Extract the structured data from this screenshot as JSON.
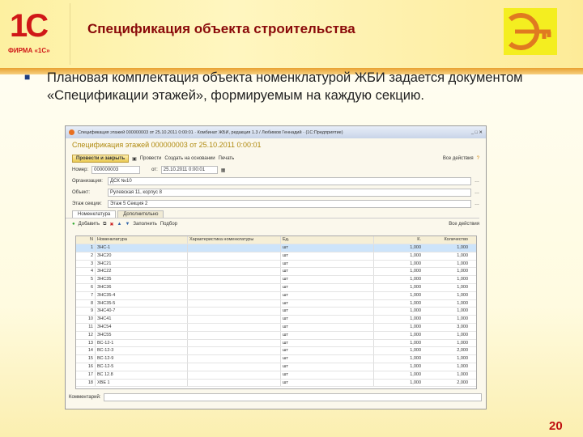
{
  "slide": {
    "title": "Спецификация объекта строительства",
    "logo_text": "1С",
    "logo_caption": "ФИРМА «1С»",
    "bullet": "Плановая комплектация объекта номенклатурой ЖБИ задается документом «Спецификации этажей», формируемым на каждую секцию.",
    "page_number": "20"
  },
  "window": {
    "titlebar": "Спецификация этажей 000000003 от 25.10.2011 0:00:01 · Комбинат ЖБИ, редакция 1.3 / Любимов Геннадий · (1С:Предприятие)",
    "doc_title": "Спецификация этажей 000000003 от 25.10.2011 0:00:01",
    "toolbar": {
      "post_close": "Провести и закрыть",
      "post": "Провести",
      "create_based": "Создать на основании",
      "print": "Печать",
      "all_actions": "Все действия"
    },
    "fields": {
      "number_label": "Номер:",
      "number": "000000003",
      "date_label": "от:",
      "date": "25.10.2011 0:00:01",
      "org_label": "Организация:",
      "org": "ДСК №10",
      "object_label": "Объект:",
      "object": "Рулевская 11, корпус 8",
      "section_label": "Этаж секции:",
      "section": "Этаж 5 Секция 2"
    },
    "tabs": [
      "Номенклатура",
      "Дополнительно"
    ],
    "table_toolbar": {
      "add": "Добавить",
      "fill": "Заполнить",
      "pick": "Подбор",
      "all_actions": "Все действия"
    },
    "table": {
      "headers": [
        "N",
        "Номенклатура",
        "Характеристика номенклатуры",
        "Ед.",
        "К.",
        "Количество"
      ],
      "rows": [
        [
          "1",
          "ЗНС-1",
          "",
          "шт",
          "1,000",
          "1,000"
        ],
        [
          "2",
          "ЗНС20",
          "",
          "шт",
          "1,000",
          "1,000"
        ],
        [
          "3",
          "ЗНС21",
          "",
          "шт",
          "1,000",
          "1,000"
        ],
        [
          "4",
          "ЗНС22",
          "",
          "шт",
          "1,000",
          "1,000"
        ],
        [
          "5",
          "ЗНС35",
          "",
          "шт",
          "1,000",
          "1,000"
        ],
        [
          "6",
          "ЗНС36",
          "",
          "шт",
          "1,000",
          "1,000"
        ],
        [
          "7",
          "ЗНС35-4",
          "",
          "шт",
          "1,000",
          "1,000"
        ],
        [
          "8",
          "ЗНС35-5",
          "",
          "шт",
          "1,000",
          "1,000"
        ],
        [
          "9",
          "ЗНС40-7",
          "",
          "шт",
          "1,000",
          "1,000"
        ],
        [
          "10",
          "ЗНС41",
          "",
          "шт",
          "1,000",
          "1,000"
        ],
        [
          "11",
          "ЗНС54",
          "",
          "шт",
          "1,000",
          "3,000"
        ],
        [
          "12",
          "ЗНС55",
          "",
          "шт",
          "1,000",
          "1,000"
        ],
        [
          "13",
          "ВС-12-1",
          "",
          "шт",
          "1,000",
          "1,000"
        ],
        [
          "14",
          "ВС-12-3",
          "",
          "шт",
          "1,000",
          "2,000"
        ],
        [
          "15",
          "ВС-12-9",
          "",
          "шт",
          "1,000",
          "1,000"
        ],
        [
          "16",
          "ВС-12-5",
          "",
          "шт",
          "1,000",
          "1,000"
        ],
        [
          "17",
          "ВС 12.8",
          "",
          "шт",
          "1,000",
          "1,000"
        ],
        [
          "18",
          "ХВЕ 1",
          "",
          "шт",
          "1,000",
          "2,000"
        ]
      ]
    },
    "comment_label": "Комментарий:",
    "comment": ""
  }
}
